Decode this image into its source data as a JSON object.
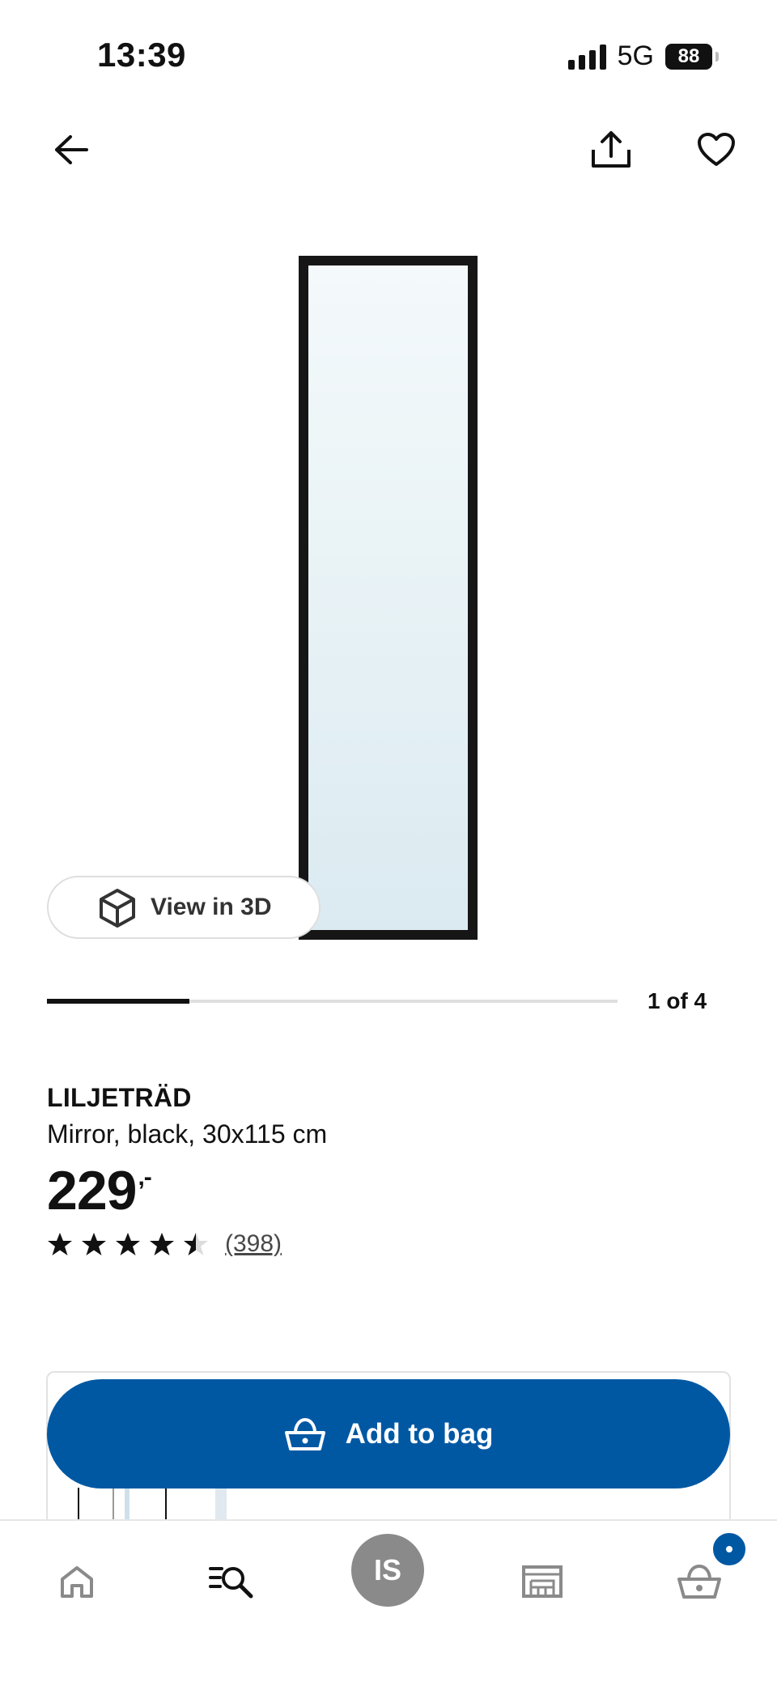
{
  "status_bar": {
    "time": "13:39",
    "network": "5G",
    "battery": "88"
  },
  "header": {
    "back_icon": "arrow-left-icon",
    "share_icon": "share-icon",
    "favorite_icon": "heart-icon"
  },
  "gallery": {
    "view_3d_label": "View in 3D",
    "page_indicator": "1 of 4",
    "progress_fraction": 0.25
  },
  "product": {
    "name": "LILJETRÄD",
    "description": "Mirror, black, 30x115 cm",
    "price": "229",
    "price_suffix": ",-",
    "rating": 4.5,
    "review_count": "(398)"
  },
  "cta": {
    "add_to_bag_label": "Add to bag"
  },
  "bottom_nav": {
    "items": [
      "home-icon",
      "search-list-icon",
      "profile-avatar",
      "store-icon",
      "cart-icon"
    ],
    "avatar_initials": "IS"
  },
  "colors": {
    "brand_blue": "#0058a3",
    "avatar_gray": "#8a8a8a"
  }
}
